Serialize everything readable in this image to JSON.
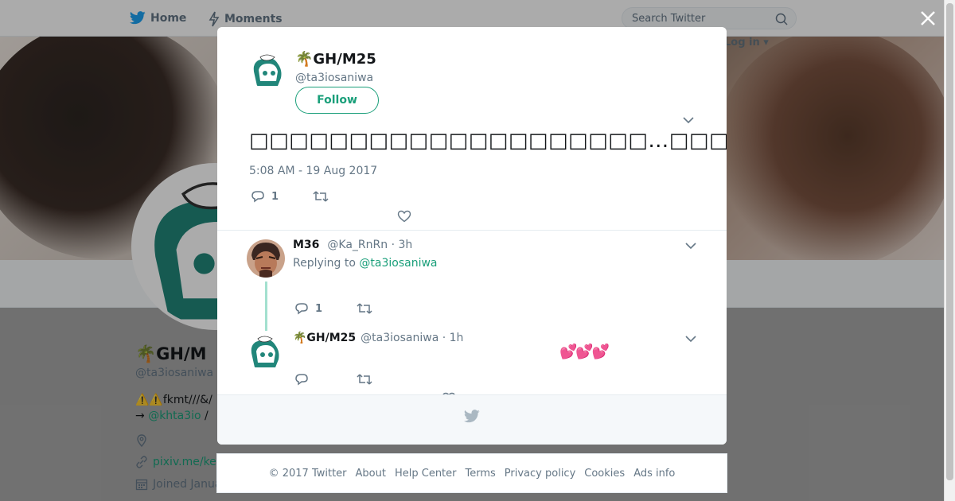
{
  "nav": {
    "home_label": "Home",
    "moments_label": "Moments",
    "search_placeholder": "Search Twitter",
    "login_label": "Log in",
    "login_caret": "▾"
  },
  "profile": {
    "name": "🌴GH/M",
    "handle": "@ta3iosaniwa",
    "bio_line1": "⚠️⚠️fkmt///&/",
    "bio_arrow": "→ ",
    "bio_link": "@khta3io",
    "bio_sep": " /",
    "url": "pixiv.me/ke",
    "joined": "Joined Janua"
  },
  "tweet": {
    "author_name": "🌴GH/M25",
    "author_handle": "@ta3iosaniwa",
    "follow_label": "Follow",
    "text": "□□□□□□□□□□□□□□□□□□□□…□□□□□□□□□□□□□□□□□□□□□□□□□□□□□",
    "timestamp": "5:08 AM - 19 Aug 2017",
    "reply_count": "1",
    "retweet_count": "",
    "like_count": ""
  },
  "replies": [
    {
      "name": "M36",
      "handle": "@Ka_RnRn",
      "time": "· 3h",
      "replying_prefix": "Replying to ",
      "replying_to": "@ta3iosaniwa",
      "reply_count": "1"
    },
    {
      "name": "🌴GH/M25",
      "handle": "@ta3iosaniwa",
      "time": "· 1h",
      "text": "💕💕💕",
      "reply_count": ""
    }
  ],
  "footer": {
    "copyright": "© 2017 Twitter",
    "about": "About",
    "help": "Help Center",
    "terms": "Terms",
    "privacy": "Privacy policy",
    "cookies": "Cookies",
    "ads": "Ads info"
  },
  "colors": {
    "accent": "#1a9f7a",
    "twitter_blue": "#1da1f2",
    "muted": "#657786",
    "heart": "#e0245e"
  },
  "icons": [
    "twitter-bird-icon",
    "lightning-icon",
    "search-icon",
    "close-icon",
    "reply-icon",
    "retweet-icon",
    "heart-icon",
    "chevron-down-icon",
    "location-icon",
    "link-icon",
    "calendar-icon"
  ]
}
